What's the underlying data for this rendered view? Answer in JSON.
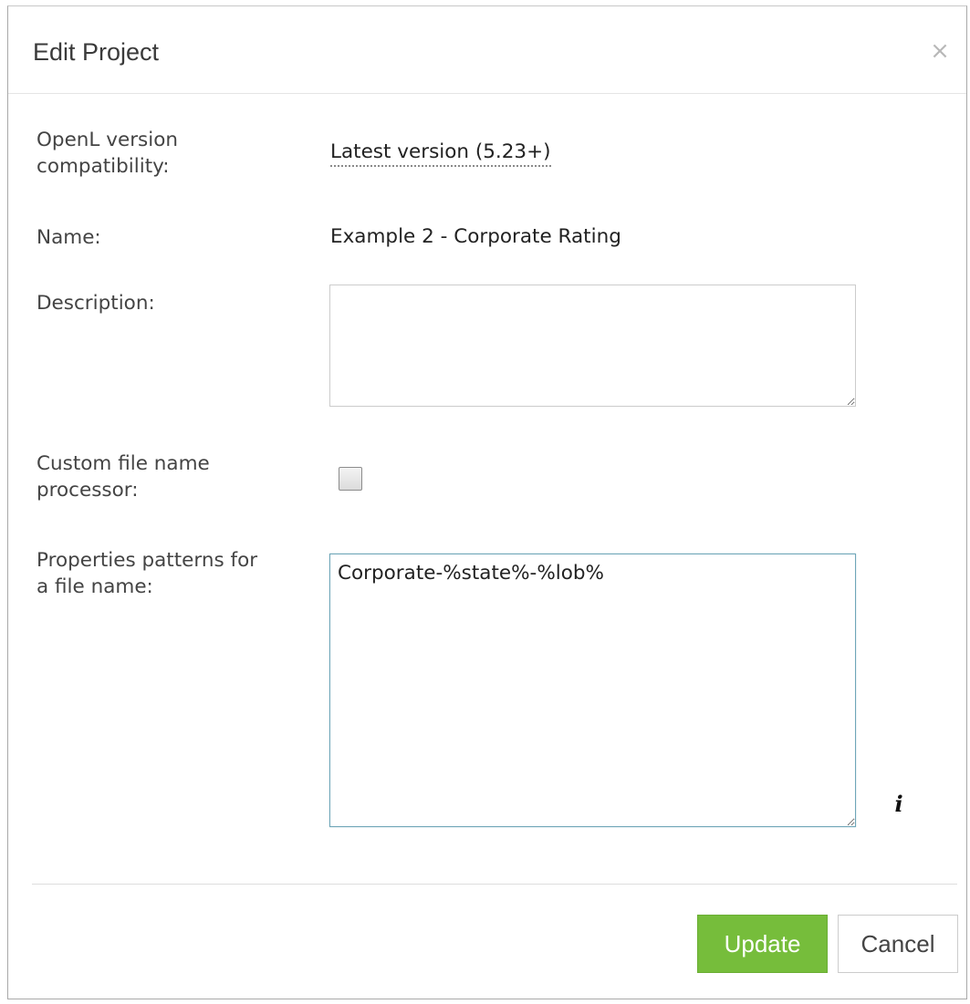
{
  "dialog": {
    "title": "Edit Project",
    "close_glyph": "×"
  },
  "form": {
    "openl_version": {
      "label_line1": "OpenL version",
      "label_line2": "compatibility:",
      "value": "Latest version (5.23+)"
    },
    "name": {
      "label": "Name:",
      "value": "Example 2 - Corporate Rating"
    },
    "description": {
      "label": "Description:",
      "value": ""
    },
    "custom_file_name_processor": {
      "label_line1": "Custom file name",
      "label_line2": "processor:",
      "checked": false
    },
    "properties_patterns": {
      "label_line1": "Properties patterns for",
      "label_line2": "a file name:",
      "value": "Corporate-%state%-%lob%"
    },
    "info_icon": "info-icon"
  },
  "footer": {
    "update_label": "Update",
    "cancel_label": "Cancel"
  },
  "colors": {
    "update_button": "#76bd3b",
    "focused_border": "#6fa6b8"
  }
}
